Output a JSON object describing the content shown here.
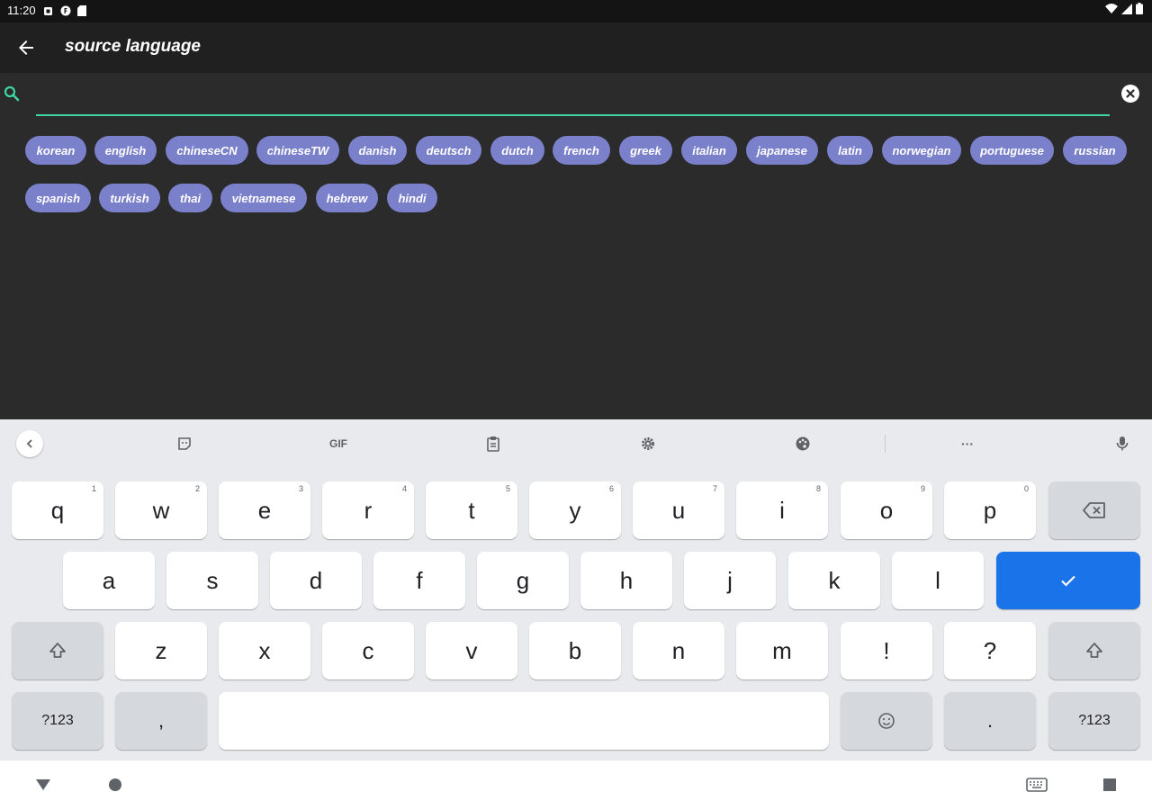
{
  "status_bar": {
    "time": "11:20"
  },
  "app_bar": {
    "title": "source language"
  },
  "search": {
    "placeholder": "",
    "value": ""
  },
  "chips": [
    "korean",
    "english",
    "chineseCN",
    "chineseTW",
    "danish",
    "deutsch",
    "dutch",
    "french",
    "greek",
    "italian",
    "japanese",
    "latin",
    "norwegian",
    "portuguese",
    "russian",
    "spanish",
    "turkish",
    "thai",
    "vietnamese",
    "hebrew",
    "hindi"
  ],
  "keyboard_toolbar": {
    "gif_label": "GIF",
    "more_label": "···"
  },
  "keyboard": {
    "row1": [
      {
        "label": "q",
        "hint": "1"
      },
      {
        "label": "w",
        "hint": "2"
      },
      {
        "label": "e",
        "hint": "3"
      },
      {
        "label": "r",
        "hint": "4"
      },
      {
        "label": "t",
        "hint": "5"
      },
      {
        "label": "y",
        "hint": "6"
      },
      {
        "label": "u",
        "hint": "7"
      },
      {
        "label": "i",
        "hint": "8"
      },
      {
        "label": "o",
        "hint": "9"
      },
      {
        "label": "p",
        "hint": "0"
      }
    ],
    "row2": [
      "a",
      "s",
      "d",
      "f",
      "g",
      "h",
      "j",
      "k",
      "l"
    ],
    "row3": [
      "z",
      "x",
      "c",
      "v",
      "b",
      "n",
      "m",
      "!",
      "?"
    ],
    "symbols_label": "?123",
    "comma_label": ",",
    "period_label": "."
  },
  "colors": {
    "accent": "#3fd6a4",
    "chip": "#7a80ca",
    "enter": "#1a73e8"
  }
}
